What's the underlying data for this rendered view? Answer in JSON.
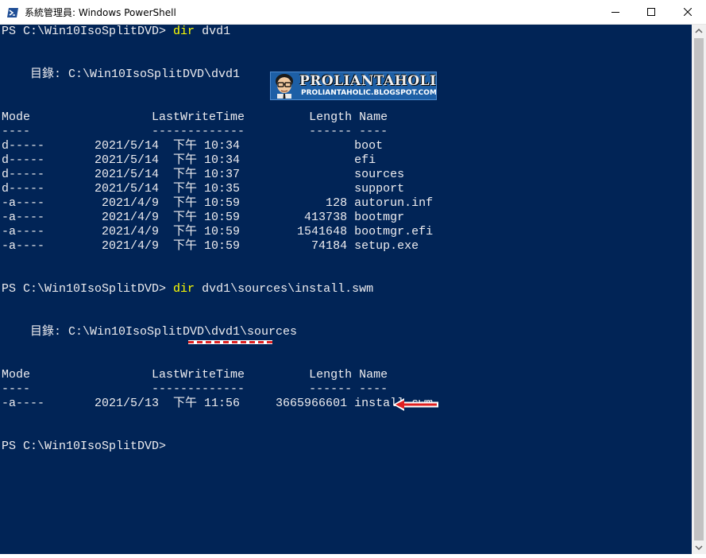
{
  "window": {
    "title": "系統管理員: Windows PowerShell",
    "buttons": {
      "minimize": "minimize",
      "maximize": "maximize",
      "close": "close"
    },
    "console_bg": "#012456",
    "command_color": "#ffff00"
  },
  "console": {
    "prompt1": {
      "prompt": "PS C:\\Win10IsoSplitDVD> ",
      "cmd": "dir",
      "args": " dvd1"
    },
    "dir1_header": "    目錄: C:\\Win10IsoSplitDVD\\dvd1",
    "columns_line": "Mode                 LastWriteTime         Length Name",
    "separator_line": "----                 -------------         ------ ----",
    "listing1": [
      "d-----       2021/5/14  下午 10:34                boot",
      "d-----       2021/5/14  下午 10:34                efi",
      "d-----       2021/5/14  下午 10:37                sources",
      "d-----       2021/5/14  下午 10:35                support",
      "-a----        2021/4/9  下午 10:59            128 autorun.inf",
      "-a----        2021/4/9  下午 10:59         413738 bootmgr",
      "-a----        2021/4/9  下午 10:59        1541648 bootmgr.efi",
      "-a----        2021/4/9  下午 10:59          74184 setup.exe"
    ],
    "prompt2": {
      "prompt": "PS C:\\Win10IsoSplitDVD> ",
      "cmd": "dir",
      "args": " dvd1\\sources\\install.swm"
    },
    "dir2_header": "    目錄: C:\\Win10IsoSplitDVD\\dvd1\\sources",
    "listing2": [
      "-a----       2021/5/13  下午 11:56     3665966601 install.swm"
    ],
    "prompt3": "PS C:\\Win10IsoSplitDVD>"
  },
  "watermark": {
    "title": "PROLIANTAHOLIC",
    "url": "PROLIANTAHOLIC.BLOGSPOT.COM"
  },
  "annotations": {
    "underline_color": "#e02020",
    "arrow_color": "#e02020",
    "arrow_target": "install.swm"
  }
}
